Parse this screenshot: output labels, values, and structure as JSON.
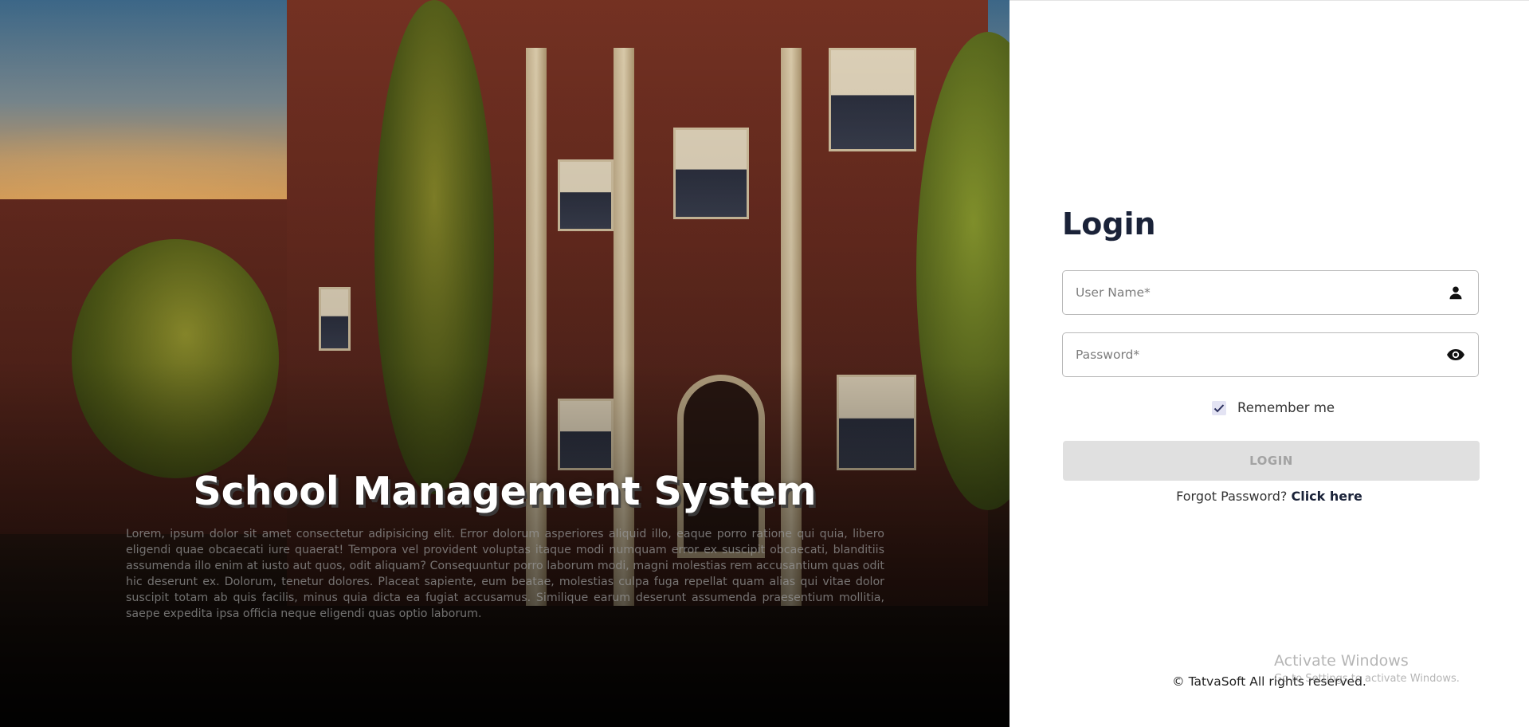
{
  "hero": {
    "title": "School Management System",
    "description": "Lorem, ipsum dolor sit amet consectetur adipisicing elit. Error dolorum asperiores aliquid illo, eaque porro ratione qui quia, libero eligendi quae obcaecati iure quaerat! Tempora vel provident voluptas itaque modi numquam error ex suscipit obcaecati, blanditiis assumenda illo enim at iusto aut quos, odit aliquam? Consequuntur porro laborum modi, magni molestias rem accusantium quas odit hic deserunt ex. Dolorum, tenetur dolores. Placeat sapiente, eum beatae, molestias culpa fuga repellat quam alias qui vitae dolor suscipit totam ab quis facilis, minus quia dicta ea fugiat accusamus. Similique earum deserunt assumenda praesentium mollitia, saepe expedita ipsa officia neque eligendi quas optio laborum.",
    "image_icon": "school-building-image"
  },
  "login": {
    "title": "Login",
    "username": {
      "placeholder": "User Name*",
      "value": "",
      "icon": "person-icon"
    },
    "password": {
      "placeholder": "Password*",
      "value": "",
      "icon": "eye-icon"
    },
    "remember_label": "Remember me",
    "remember_checked": true,
    "button_label": "LOGIN",
    "forgot_text": "Forgot Password?",
    "forgot_link": "Click here",
    "footer": "© TatvaSoft All rights reserved."
  },
  "watermark": {
    "line1": "Activate Windows",
    "line2": "Go to Settings to activate Windows."
  },
  "colors": {
    "title": "#1a2238",
    "button_bg": "#e0e0e0",
    "button_text": "#a3a3a3",
    "checkbox_bg": "#e3e3f3"
  }
}
